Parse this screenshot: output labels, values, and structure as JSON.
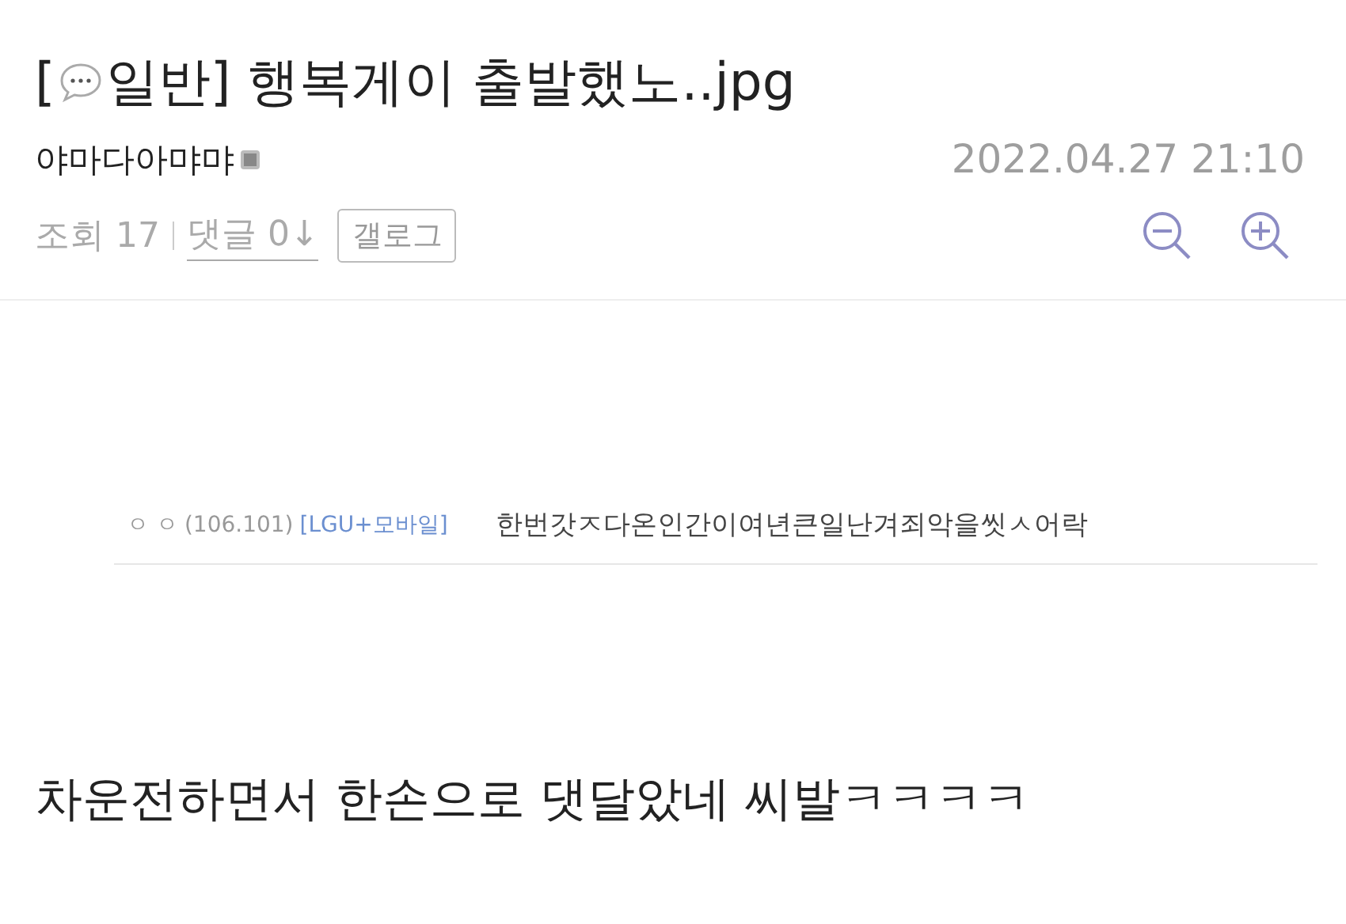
{
  "post": {
    "title_prefix": "[",
    "category": "일반]",
    "title": "행복게이 출발했노..jpg",
    "author": "야마다아먀먀",
    "date": "2022.04.27 21:10",
    "views": "조회 17",
    "comments_link": "댓글 0↓",
    "gallog_button": "갤로그"
  },
  "quoted_comment": {
    "name": "ㅇ ㅇ",
    "ip": "(106.101)",
    "carrier": "[LGU+모바일]",
    "text": "한번갓ㅈ다온인간이여년큰일난겨죄악을씻ㅅ어락"
  },
  "body_text": "차운전하면서 한손으로 댓달았네 씨발ㅋㅋㅋㅋ"
}
